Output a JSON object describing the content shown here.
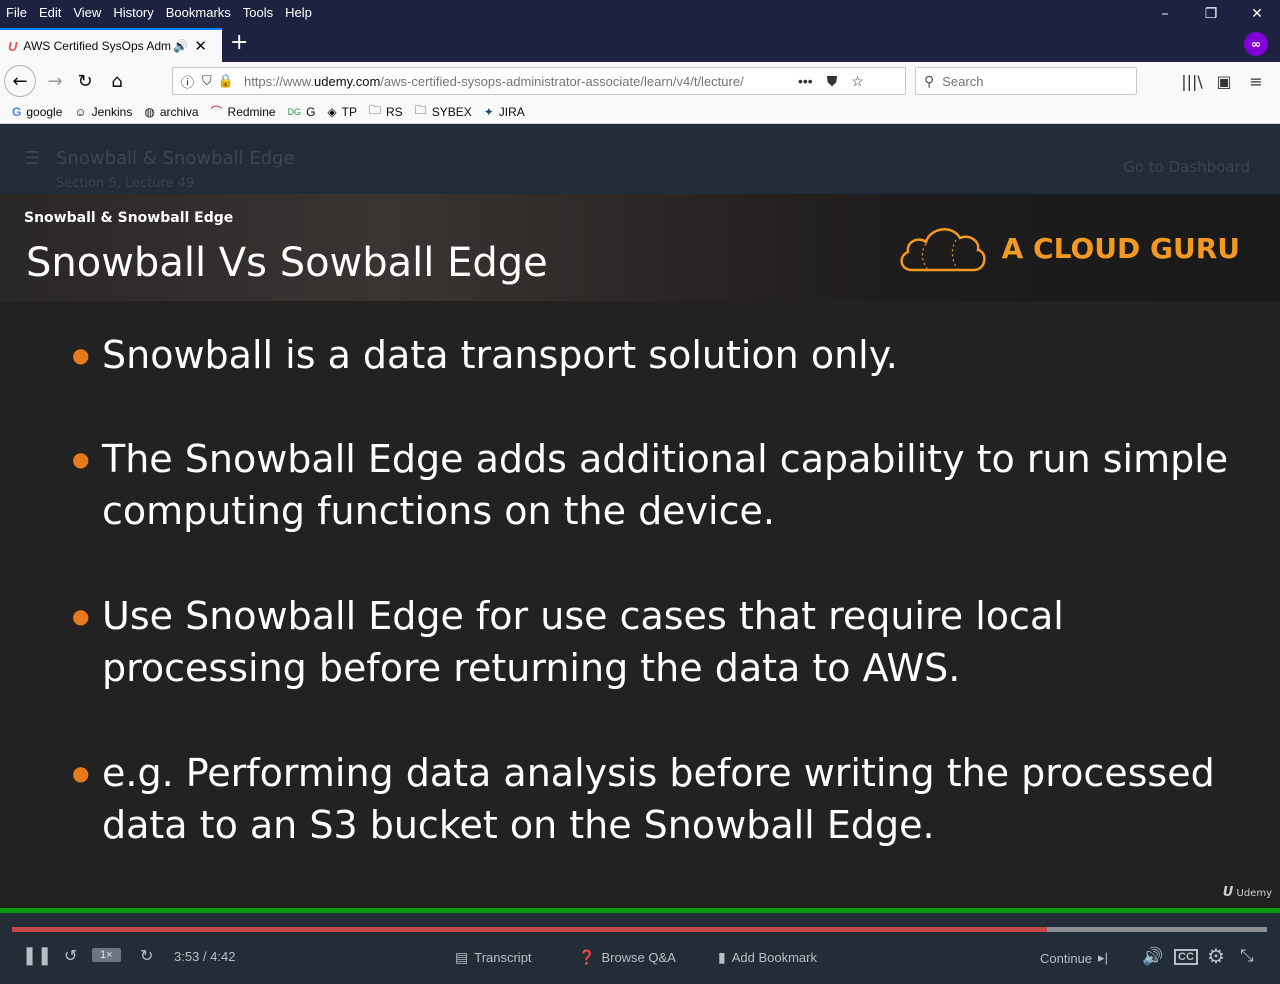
{
  "menubar": {
    "items": [
      "File",
      "Edit",
      "View",
      "History",
      "Bookmarks",
      "Tools",
      "Help"
    ]
  },
  "window_controls": {
    "minimize": "–",
    "restore": "❐",
    "close": "✕"
  },
  "tab": {
    "title": "AWS Certified SysOps Admini",
    "favicon": "udemy-icon",
    "audio_icon": "speaker-icon",
    "close": "✕",
    "new_tab": "+"
  },
  "navbar": {
    "url_prefix": "https://www.",
    "url_domain": "udemy.com",
    "url_rest": "/aws-certified-sysops-administrator-associate/learn/v4/t/lecture/",
    "more": "•••",
    "search_placeholder": "Search"
  },
  "bookmarks": [
    {
      "label": "google",
      "icon": "google-icon"
    },
    {
      "label": "Jenkins",
      "icon": "jenkins-icon"
    },
    {
      "label": "archiva",
      "icon": "globe-icon"
    },
    {
      "label": "Redmine",
      "icon": "redmine-icon"
    },
    {
      "label": "G",
      "icon": "g-icon"
    },
    {
      "label": "TP",
      "icon": "diamond-icon"
    },
    {
      "label": "RS",
      "icon": "folder-icon"
    },
    {
      "label": "SYBEX",
      "icon": "folder-icon"
    },
    {
      "label": "JIRA",
      "icon": "jira-icon"
    }
  ],
  "lecture_header": {
    "title": "Snowball & Snowball Edge",
    "section": "Section 5, Lecture 49",
    "dashboard_link": "Go to Dashboard"
  },
  "slide": {
    "subtitle": "Snowball & Snowball Edge",
    "title": "Snowball Vs Sowball Edge",
    "brand": "A CLOUD GURU",
    "bullets": [
      "Snowball is a data transport solution only.",
      "The Snowball Edge adds additional capability to run simple computing functions on the device.",
      "Use Snowball Edge for use cases that require local processing before returning the data to AWS.",
      "e.g. Performing data analysis before writing the processed data to an S3 bucket on the Snowball Edge."
    ],
    "watermark": "Udemy"
  },
  "player": {
    "time": "3:53 / 4:42",
    "progress_fraction": 0.825,
    "rate": "1×",
    "transcript": "Transcript",
    "browse_qa": "Browse Q&A",
    "add_bookmark": "Add Bookmark",
    "continue": "Continue"
  }
}
